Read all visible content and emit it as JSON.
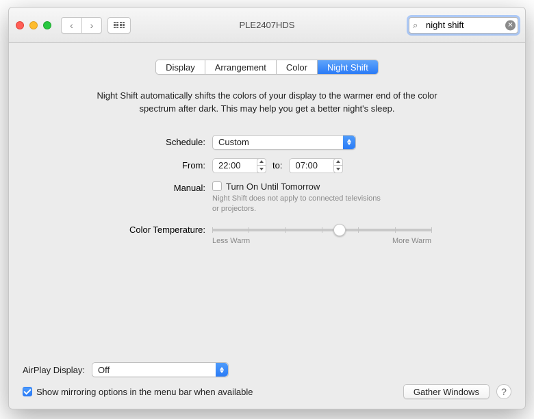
{
  "window": {
    "title": "PLE2407HDS"
  },
  "search": {
    "value": "night shift"
  },
  "tabs": {
    "display": "Display",
    "arrangement": "Arrangement",
    "color": "Color",
    "night_shift": "Night Shift"
  },
  "description": "Night Shift automatically shifts the colors of your display to the warmer end of the color spectrum after dark. This may help you get a better night's sleep.",
  "schedule": {
    "label": "Schedule:",
    "value": "Custom"
  },
  "from": {
    "label": "From:",
    "value": "22:00",
    "to_label": "to:",
    "to_value": "07:00"
  },
  "manual": {
    "label": "Manual:",
    "checkbox_label": "Turn On Until Tomorrow",
    "hint": "Night Shift does not apply to connected televisions or projectors."
  },
  "color_temp": {
    "label": "Color Temperature:",
    "less": "Less Warm",
    "more": "More Warm",
    "position_pct": 58
  },
  "airplay": {
    "label": "AirPlay Display:",
    "value": "Off"
  },
  "mirroring_label": "Show mirroring options in the menu bar when available",
  "gather_label": "Gather Windows"
}
